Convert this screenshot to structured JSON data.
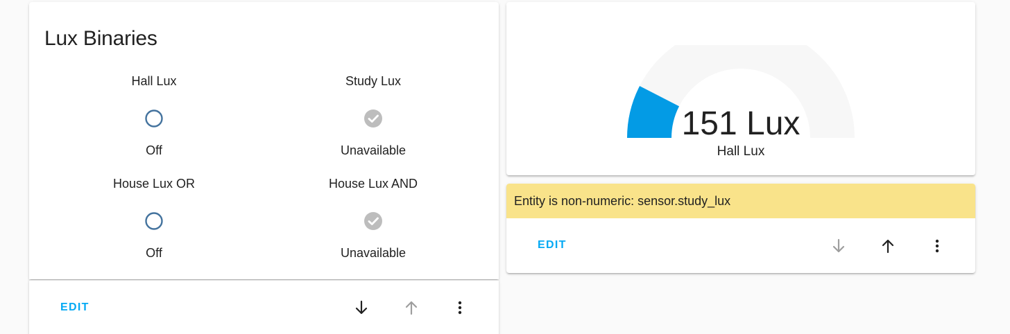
{
  "lux_binaries_card": {
    "title": "Lux Binaries",
    "entities": [
      {
        "name": "Hall Lux",
        "state": "Off",
        "icon": "radiobox-blank-icon"
      },
      {
        "name": "Study Lux",
        "state": "Unavailable",
        "icon": "check-circle-icon"
      },
      {
        "name": "House Lux OR",
        "state": "Off",
        "icon": "radiobox-blank-icon"
      },
      {
        "name": "House Lux AND",
        "state": "Unavailable",
        "icon": "check-circle-icon"
      }
    ],
    "actions": {
      "edit_label": "EDIT",
      "move_down_icon": "arrow-down-icon",
      "move_up_icon": "arrow-up-icon",
      "menu_icon": "dots-vertical-icon",
      "move_up_disabled": true
    }
  },
  "gauge_card": {
    "value_text": "151 Lux",
    "name": "Hall Lux",
    "level_fraction": 0.151,
    "fill_color": "#039be5",
    "track_color": "#f7f7f7"
  },
  "warning_card": {
    "message": "Entity is non-numeric: sensor.study_lux",
    "banner_color": "#f9e38a",
    "actions": {
      "edit_label": "EDIT",
      "move_down_icon": "arrow-down-icon",
      "move_up_icon": "arrow-up-icon",
      "menu_icon": "dots-vertical-icon",
      "move_down_disabled": true
    }
  },
  "colors": {
    "accent": "#03a9f4",
    "off_icon": "#44739e",
    "unavailable_icon": "#bdbdbd",
    "disabled_icon": "#9e9e9e"
  }
}
